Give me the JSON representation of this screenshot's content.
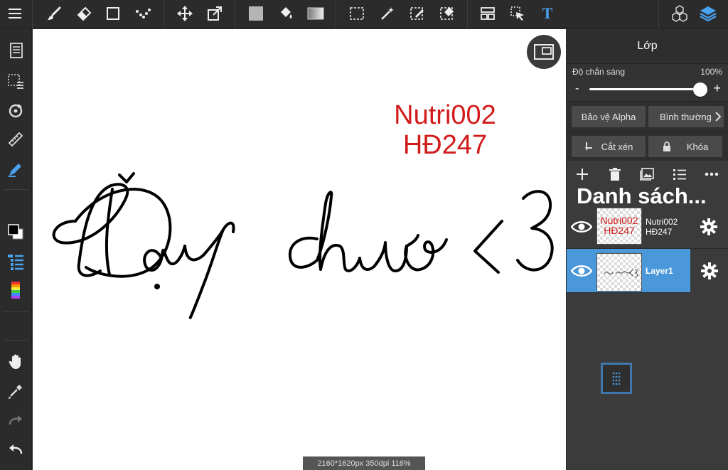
{
  "toolbar": {
    "icons": [
      "menu-icon",
      "brush-icon",
      "eraser-icon",
      "rectangle-icon",
      "dot-select-icon",
      "move-icon",
      "transform-icon",
      "fill-color-icon",
      "bucket-icon",
      "gradient-icon",
      "select-rect-icon",
      "magic-wand-icon",
      "select-pen-icon",
      "select-eraser-icon",
      "panel-layout-icon",
      "select-cursor-icon",
      "text-icon",
      "materials-icon",
      "layers-icon"
    ],
    "text_tool_label": "T",
    "accent": "#4aa3f0"
  },
  "canvas": {
    "red_text_line1": "Nutri002",
    "red_text_line2": "HĐ247",
    "red_color": "#d21c1c",
    "status": "2160*1620px 350dpi 116%"
  },
  "panel": {
    "title": "Lớp",
    "opacity_label": "Độ chắn sáng",
    "opacity_value": "100%",
    "opacity_level": 1.0,
    "minus": "-",
    "plus": "+",
    "protect_alpha": "Bảo vệ Alpha",
    "blend_mode": "Bình thường",
    "clip": "Cắt xén",
    "lock": "Khóa",
    "list_title": "Danh sách...",
    "layers": [
      {
        "name_line1": "Nutri002",
        "name_line2": "HĐ247",
        "selected": false
      },
      {
        "name_line1": "Layer1",
        "name_line2": "",
        "selected": true
      }
    ]
  }
}
